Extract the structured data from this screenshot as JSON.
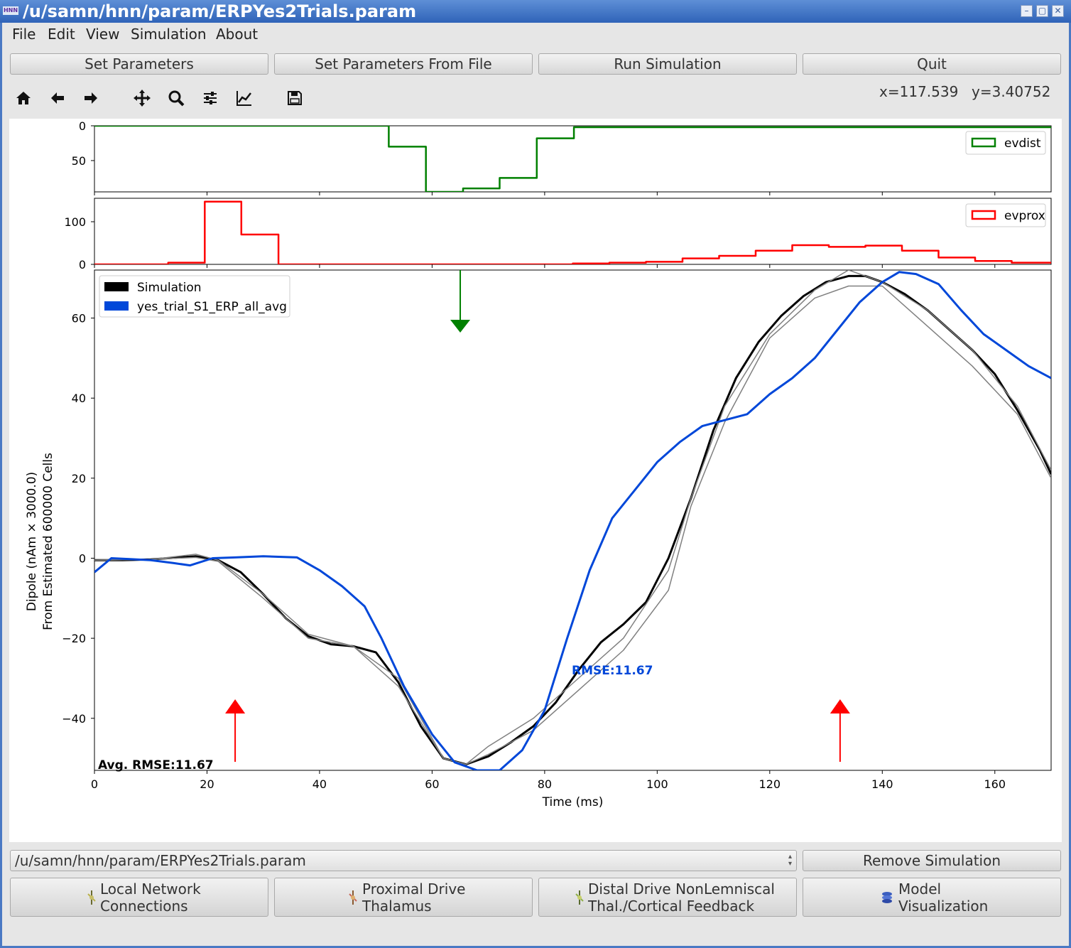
{
  "window": {
    "title": "/u/samn/hnn/param/ERPYes2Trials.param",
    "logo_text": "HNN",
    "controls": [
      "minimize-icon",
      "maximize-icon",
      "close-icon"
    ]
  },
  "menu": [
    "File",
    "Edit",
    "View",
    "Simulation",
    "About"
  ],
  "top_buttons": [
    "Set Parameters",
    "Set Parameters From File",
    "Run Simulation",
    "Quit"
  ],
  "toolbar": {
    "icons": [
      "home-icon",
      "back-arrow-icon",
      "forward-arrow-icon",
      "pan-icon",
      "zoom-icon",
      "configure-subplots-icon",
      "edit-axis-icon",
      "save-icon"
    ],
    "x_readout": "x=117.539",
    "y_readout": "y=3.40752"
  },
  "colors": {
    "evdist": "#008000",
    "evprox": "#ff0000",
    "simulation": "#000000",
    "trials": "#808080",
    "data": "#0047d9"
  },
  "chart_data": [
    {
      "type": "line",
      "panel": "evdist",
      "style": "step",
      "legend": [
        "evdist"
      ],
      "legend_position": "upper right",
      "y_inverted": true,
      "yticks": [
        "0",
        "50"
      ],
      "ylim": [
        0,
        95
      ],
      "xlim": [
        0,
        170
      ],
      "series": [
        {
          "name": "evdist",
          "x": [
            0,
            52.3,
            52.3,
            58.9,
            58.9,
            65.5,
            65.5,
            72.0,
            72.0,
            78.6,
            78.6,
            85.2,
            85.2,
            170
          ],
          "y": [
            0,
            0,
            30,
            30,
            95,
            95,
            90,
            90,
            75,
            75,
            18,
            18,
            2,
            2
          ]
        }
      ]
    },
    {
      "type": "line",
      "panel": "evprox",
      "style": "step",
      "legend": [
        "evprox"
      ],
      "legend_position": "upper right",
      "yticks": [
        "0",
        "100"
      ],
      "ylim": [
        0,
        155
      ],
      "xlim": [
        0,
        170
      ],
      "series": [
        {
          "name": "evprox",
          "x": [
            0,
            13.1,
            13.1,
            19.6,
            19.6,
            26.1,
            26.1,
            32.7,
            32.7,
            85.0,
            85.0,
            91.5,
            91.5,
            98.0,
            98.0,
            104.5,
            104.5,
            111.0,
            111.0,
            117.5,
            117.5,
            124.0,
            124.0,
            130.5,
            130.5,
            137.0,
            137.0,
            143.5,
            143.5,
            150.0,
            150.0,
            156.5,
            156.5,
            163.0,
            163.0,
            170
          ],
          "y": [
            0,
            0,
            4,
            4,
            147,
            147,
            70,
            70,
            0,
            0,
            2,
            2,
            4,
            4,
            6,
            6,
            14,
            14,
            20,
            20,
            32,
            32,
            45,
            45,
            41,
            41,
            44,
            44,
            32,
            32,
            16,
            16,
            8,
            8,
            4,
            4
          ]
        }
      ]
    },
    {
      "type": "line",
      "panel": "dipole",
      "title": "",
      "xlabel": "Time (ms)",
      "ylabel": "Dipole (nAm × 3000.0)\nFrom Estimated 600000 Cells",
      "xlim": [
        0,
        170
      ],
      "ylim": [
        -53,
        72
      ],
      "xticks": [
        "0",
        "20",
        "40",
        "60",
        "80",
        "100",
        "120",
        "140",
        "160"
      ],
      "yticks": [
        "−40",
        "−20",
        "0",
        "20",
        "40",
        "60"
      ],
      "legend": [
        "Simulation",
        "yes_trial_S1_ERP_all_avg"
      ],
      "legend_position": "upper left",
      "annotations": {
        "rmse": "RMSE:11.67",
        "avg_rmse": "Avg. RMSE:11.67"
      },
      "markers": [
        {
          "type": "evprox arrow",
          "x": 25
        },
        {
          "type": "evdist arrow",
          "x": 65
        },
        {
          "type": "evprox arrow",
          "x": 132.5
        }
      ],
      "series": [
        {
          "name": "Simulation",
          "x": [
            0,
            5,
            10,
            15,
            18,
            22,
            26,
            30,
            34,
            38,
            42,
            46,
            50,
            54,
            58,
            62,
            66,
            70,
            74,
            78,
            82,
            86,
            90,
            94,
            98,
            102,
            106,
            110,
            114,
            118,
            122,
            126,
            130,
            134,
            137,
            140,
            144,
            148,
            152,
            156,
            160,
            164,
            168,
            170
          ],
          "y": [
            -0.5,
            -0.5,
            -0.3,
            0.2,
            0.5,
            -0.5,
            -3.5,
            -9,
            -15,
            -19.5,
            -21.5,
            -22,
            -23.5,
            -31,
            -42,
            -50,
            -51.5,
            -49.5,
            -46,
            -42,
            -36,
            -28,
            -21,
            -16.5,
            -11,
            0,
            15,
            32,
            45,
            54,
            60.5,
            65.5,
            69,
            70.5,
            70.5,
            69,
            66,
            62,
            57,
            52,
            46,
            37,
            27,
            21
          ]
        },
        {
          "name": "Trial 1",
          "x": [
            0,
            10,
            18,
            22,
            30,
            38,
            46,
            54,
            62,
            66,
            70,
            78,
            86,
            94,
            102,
            106,
            112,
            120,
            128,
            134,
            140,
            148,
            156,
            164,
            170
          ],
          "y": [
            -0.5,
            -0.3,
            1,
            -0.5,
            -9,
            -19,
            -22,
            -30,
            -50,
            -51.5,
            -47,
            -40,
            -30,
            -20,
            -3,
            15,
            38,
            56,
            67,
            72,
            69,
            62,
            52,
            38,
            22
          ]
        },
        {
          "name": "Trial 2",
          "x": [
            0,
            10,
            18,
            22,
            30,
            38,
            46,
            54,
            62,
            66,
            70,
            78,
            86,
            94,
            102,
            106,
            112,
            120,
            128,
            134,
            140,
            148,
            156,
            164,
            170
          ],
          "y": [
            -0.5,
            -0.3,
            0.2,
            -0.8,
            -10,
            -20,
            -22,
            -32,
            -50,
            -51.5,
            -49,
            -43,
            -33,
            -23,
            -8,
            13,
            34,
            55,
            65,
            68,
            68,
            58,
            48,
            36,
            20
          ]
        },
        {
          "name": "yes_trial_S1_ERP_all_avg",
          "x": [
            0,
            3,
            6,
            10,
            14,
            17,
            21,
            25,
            30,
            36,
            40,
            44,
            48,
            51,
            55,
            60,
            64,
            68,
            72,
            76,
            80,
            84,
            88,
            92,
            96,
            100,
            104,
            108,
            112,
            116,
            120,
            124,
            128,
            132,
            136,
            140,
            143,
            146,
            150,
            154,
            158,
            162,
            166,
            170
          ],
          "y": [
            -3.5,
            0,
            -0.2,
            -0.5,
            -1.2,
            -1.8,
            0,
            0.2,
            0.5,
            0.2,
            -3,
            -7,
            -12,
            -20,
            -32,
            -44,
            -51,
            -53,
            -53,
            -48,
            -38,
            -20,
            -3,
            10,
            17,
            24,
            29,
            33,
            34.5,
            36,
            41,
            45,
            50,
            57,
            64,
            69,
            71.5,
            71,
            68.5,
            62,
            56,
            52,
            48,
            45
          ]
        }
      ]
    }
  ],
  "bottom": {
    "combo_value": "/u/samn/hnn/param/ERPYes2Trials.param",
    "remove_button": "Remove Simulation",
    "panels": [
      {
        "line1": "Local Network",
        "line2": "Connections"
      },
      {
        "line1": "Proximal Drive",
        "line2": "Thalamus"
      },
      {
        "line1": "Distal Drive NonLemniscal",
        "line2": "Thal./Cortical Feedback"
      },
      {
        "line1": "Model",
        "line2": "Visualization"
      }
    ]
  }
}
